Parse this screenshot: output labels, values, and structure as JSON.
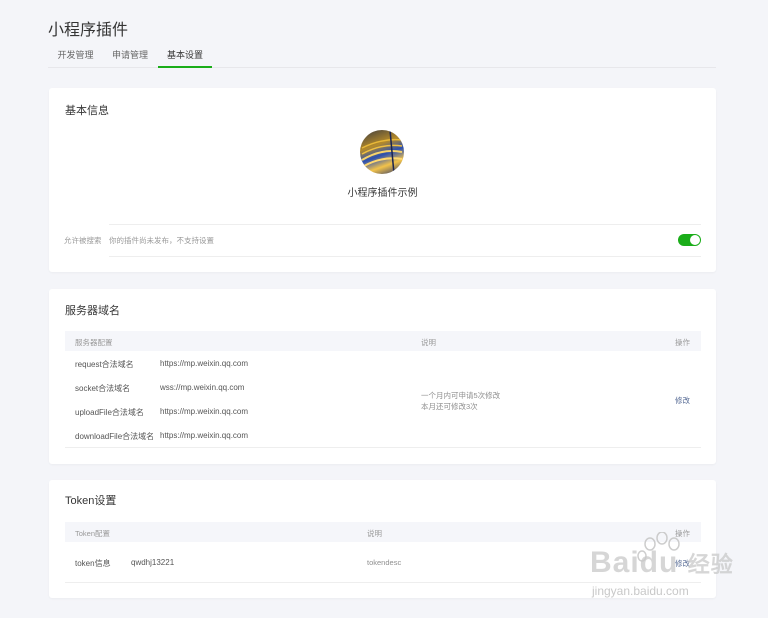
{
  "page": {
    "title": "小程序插件"
  },
  "tabs": [
    {
      "label": "开发管理"
    },
    {
      "label": "申请管理"
    },
    {
      "label": "基本设置",
      "active": true
    }
  ],
  "basic_info": {
    "title": "基本信息",
    "plugin_name": "小程序插件示例",
    "search": {
      "label": "允许被搜索",
      "description": "你的插件尚未发布，不支持设置",
      "enabled": true
    }
  },
  "server_domains": {
    "title": "服务器域名",
    "headers": {
      "config": "服务器配置",
      "desc": "说明",
      "action": "操作"
    },
    "rows": [
      {
        "label": "request合法域名",
        "value": "https://mp.weixin.qq.com"
      },
      {
        "label": "socket合法域名",
        "value": "wss://mp.weixin.qq.com"
      },
      {
        "label": "uploadFile合法域名",
        "value": "https://mp.weixin.qq.com"
      },
      {
        "label": "downloadFile合法域名",
        "value": "https://mp.weixin.qq.com"
      }
    ],
    "note_line1": "一个月内可申请5次修改",
    "note_line2": "本月还可修改3次",
    "action_label": "修改"
  },
  "token": {
    "title": "Token设置",
    "headers": {
      "config": "Token配置",
      "desc": "说明",
      "action": "操作"
    },
    "row": {
      "label": "token信息",
      "value": "qwdhj13221",
      "desc": "tokendesc",
      "action": "修改"
    }
  },
  "watermark": {
    "brand": "Baidu",
    "brand_cn": "经验",
    "url": "jingyan.baidu.com"
  },
  "colors": {
    "accent": "#1aad19",
    "link": "#576b95",
    "background": "#f4f5f9"
  }
}
